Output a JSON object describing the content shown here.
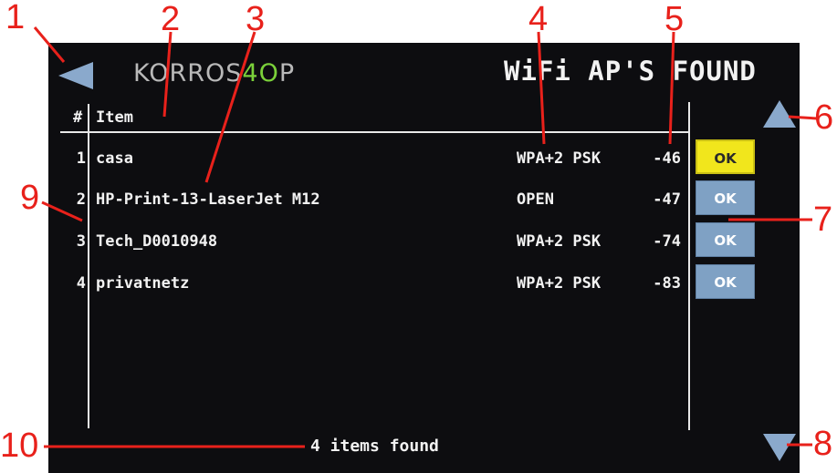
{
  "header": {
    "back_icon": "back-arrow-icon",
    "logo_main": "KORROS",
    "logo_accent": "4O",
    "logo_tail": "P",
    "title": "WiFi AP'S FOUND"
  },
  "table": {
    "columns": {
      "num": "#",
      "item": "Item"
    },
    "rows": [
      {
        "num": "1",
        "item": "casa",
        "security": "WPA+2 PSK",
        "rssi": "-46",
        "button": "OK",
        "selected": true
      },
      {
        "num": "2",
        "item": "HP-Print-13-LaserJet M12",
        "security": "OPEN",
        "rssi": "-47",
        "button": "OK",
        "selected": false
      },
      {
        "num": "3",
        "item": "Tech_D0010948",
        "security": "WPA+2 PSK",
        "rssi": "-74",
        "button": "OK",
        "selected": false
      },
      {
        "num": "4",
        "item": "privatnetz",
        "security": "WPA+2 PSK",
        "rssi": "-83",
        "button": "OK",
        "selected": false
      }
    ]
  },
  "scroll": {
    "up_icon": "scroll-up-icon",
    "down_icon": "scroll-down-icon"
  },
  "status": {
    "text": "4 items found"
  },
  "callouts": [
    "1",
    "2",
    "3",
    "4",
    "5",
    "6",
    "7",
    "8",
    "9",
    "10"
  ],
  "colors": {
    "screen_bg": "#0d0d10",
    "selected_button": "#f1e61c",
    "button": "#7fa1c4",
    "arrow": "#8aa9cc",
    "logo_accent": "#7bd13a",
    "callout": "#e8211b"
  }
}
